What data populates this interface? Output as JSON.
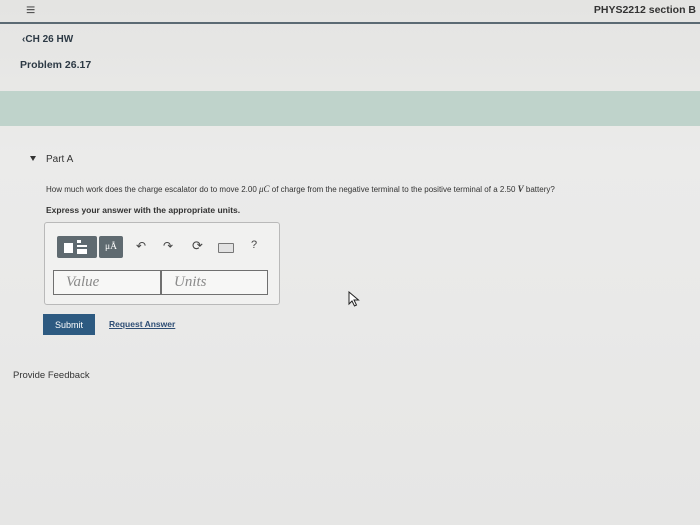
{
  "header": {
    "menu_icon": "hamburger-icon",
    "course": "PHYS2212 section B"
  },
  "nav": {
    "back_label": "CH 26 HW",
    "back_icon": "chevron-left-icon",
    "problem_title": "Problem 26.17"
  },
  "part": {
    "label": "Part A",
    "toggle_icon": "caret-down-icon"
  },
  "question": {
    "pre": "How much work does the charge escalator do to move 2.00 ",
    "charge_unit": "μC",
    "mid": " of charge from the negative terminal to the positive terminal of a 2.50 ",
    "voltage_unit": "V",
    "post": " battery?"
  },
  "instruction": "Express your answer with the appropriate units.",
  "toolbar": {
    "templates_icon": "templates-icon",
    "units_button": "μÅ",
    "undo_icon": "undo-icon",
    "redo_icon": "redo-icon",
    "reset_icon": "reset-icon",
    "keyboard_icon": "keyboard-icon",
    "help": "?"
  },
  "answer": {
    "value_placeholder": "Value",
    "units_placeholder": "Units"
  },
  "actions": {
    "submit": "Submit",
    "request_answer": "Request Answer"
  },
  "footer": {
    "feedback": "Provide Feedback"
  },
  "colors": {
    "accent": "#2d5a81",
    "band": "#bfd3cb",
    "toolbar_dark": "#5f6a70"
  }
}
